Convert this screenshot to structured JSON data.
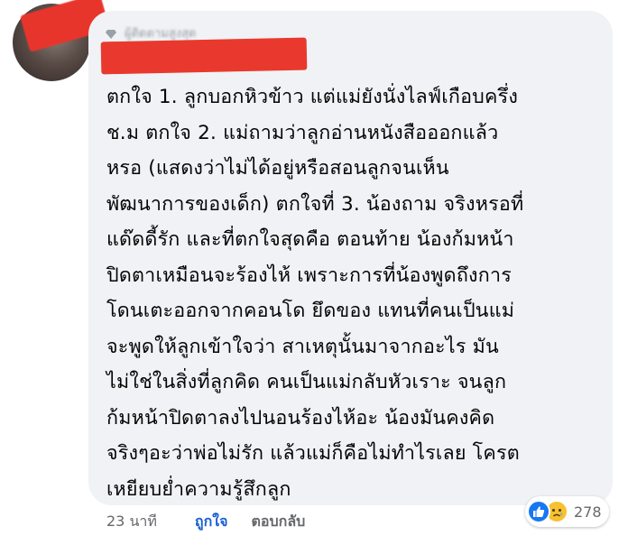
{
  "comment": {
    "author_badge": "ผู้ติดตามสูงสุด",
    "text": "ตกใจ 1. ลูกบอกหิวข้าว แต่แม่ยังนั่งไลฟ์เกือบครึ่ง\nช.ม ตกใจ 2. แม่ถามว่าลูกอ่านหนังสือออกแล้ว\nหรอ (แสดงว่าไม่ได้อยู่หรือสอนลูกจนเห็น\nพัฒนาการของเด็ก) ตกใจที่ 3. น้องถาม จริงหรอที่\nแด๊ดดี้รัก และที่ตกใจสุดคือ ตอนท้าย น้องก้มหน้า\nปิดตาเหมือนจะร้องไห้ เพราะการที่น้องพูดถึงการ\nโดนเตะออกจากคอนโด ยึดของ แทนที่คนเป็นแม่\nจะพูดให้ลูกเข้าใจว่า สาเหตุนั้นมาจากอะไร มัน\nไม่ใช่ในสิ่งที่ลูกคิด คนเป็นแม่กลับหัวเราะ จนลูก\nก้มหน้าปิดตาลงไปนอนร้องไห้อะ น้องมันคงคิด\nจริงๆอะว่าพ่อไม่รัก แล้วแม่ก็คือไม่ทำไรเลย โครต\nเหยียบย่ำความรู้สึกลูก"
  },
  "actions": {
    "time": "23 นาที",
    "like": "ถูกใจ",
    "reply": "ตอบกลับ"
  },
  "reactions": {
    "icons": [
      "like-icon",
      "sad-icon"
    ],
    "count": "278"
  },
  "colors": {
    "bubble": "#f0f2f5",
    "redaction": "#e9392e",
    "link": "#1a5fd1",
    "like_blue": "#1877f2",
    "sad_yellow": "#f7c12f"
  }
}
